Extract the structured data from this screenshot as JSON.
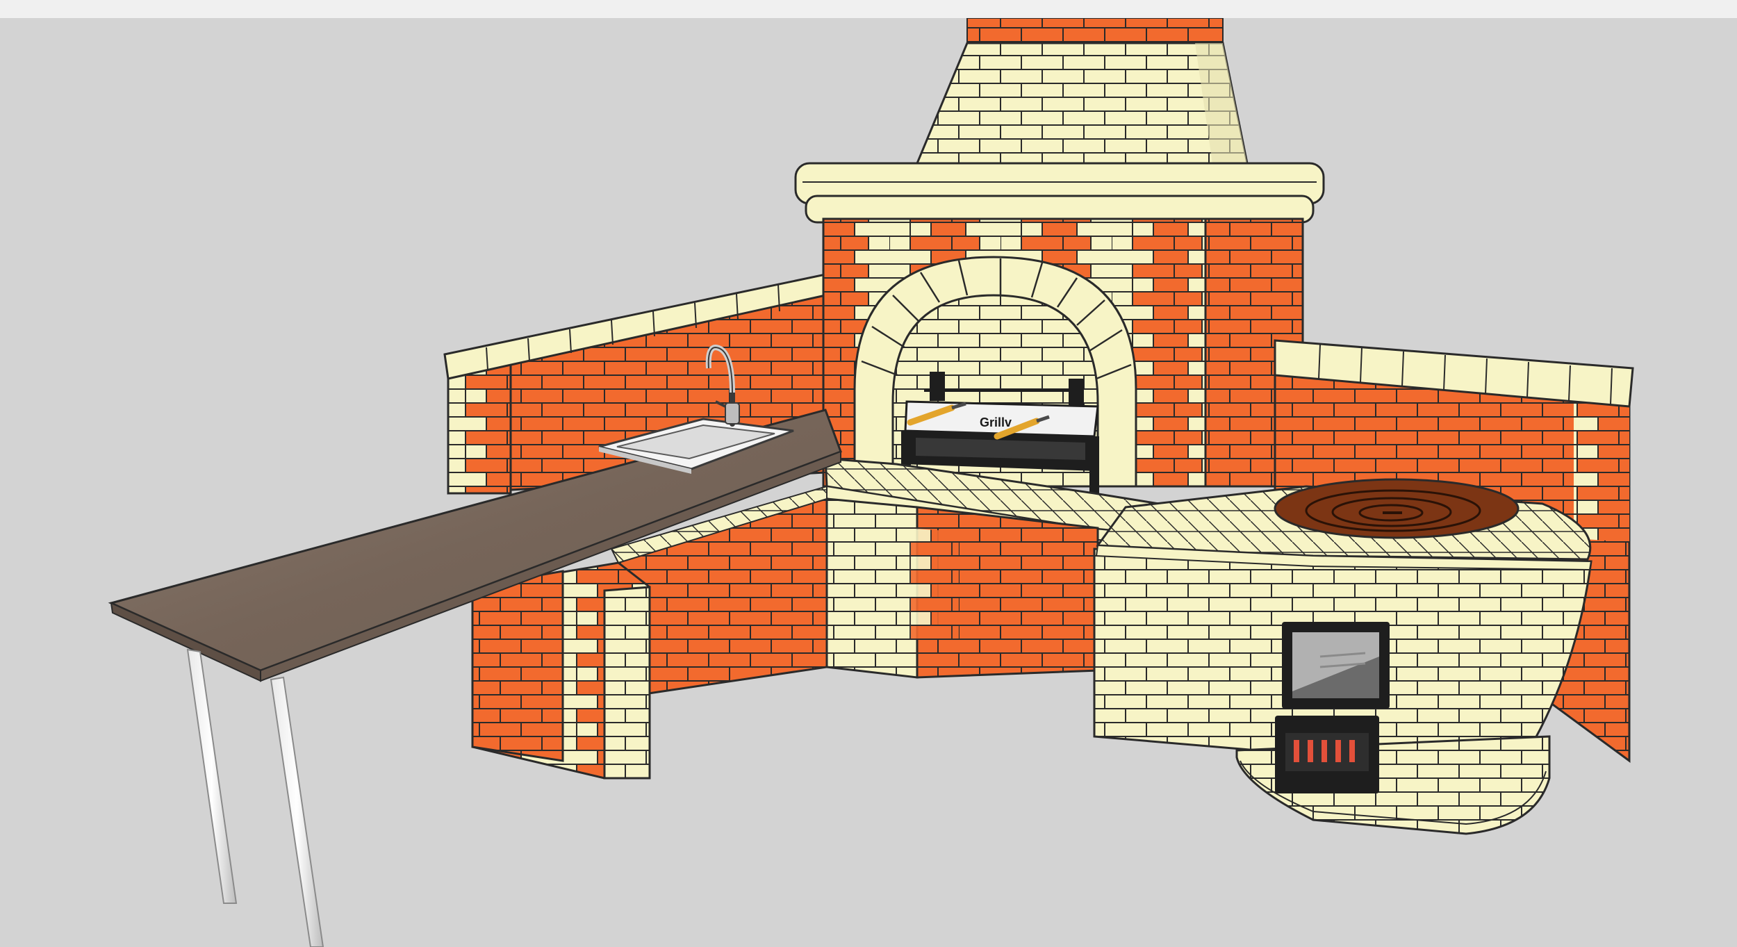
{
  "grill": {
    "brand_label": "Grillv"
  },
  "colors": {
    "canvas_bg": "#d3d3d3",
    "red_brick": "#f26a2e",
    "cream_brick": "#f7f4c6",
    "mortar": "#2a2a2a",
    "countertop": "#7a6a5f",
    "cooktop": "#7c3514"
  },
  "icons": {
    "faucet": "faucet-icon",
    "sink": "sink-icon",
    "stove_door": "firebox-door-icon",
    "ash_door": "ash-door-icon"
  }
}
